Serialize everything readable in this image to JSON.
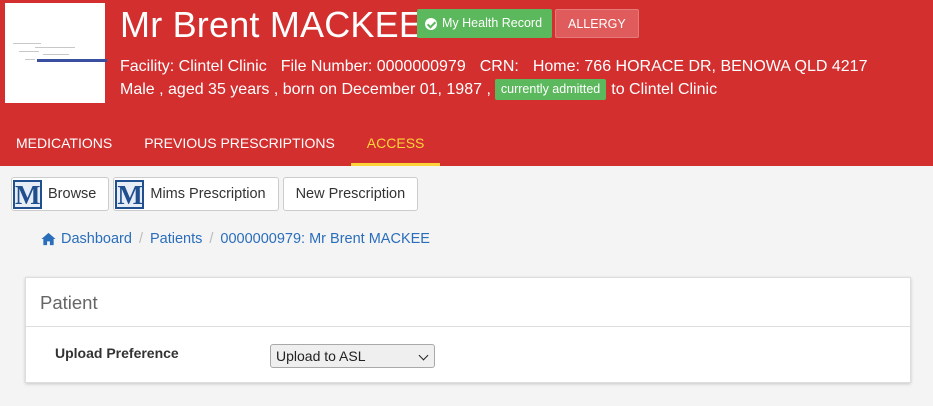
{
  "patient": {
    "name": "Mr Brent MACKEE",
    "badge_mhr": "My Health Record",
    "badge_allergy": "ALLERGY",
    "facility": "Facility: Clintel Clinic",
    "file_number": "File Number: 0000000979",
    "crn": "CRN:",
    "home": "Home: 766 HORACE DR, BENOWA QLD 4217",
    "demographics": "Male , aged 35 years , born on December 01, 1987 ,",
    "admission_status": "currently admitted",
    "admission_facility": "to Clintel Clinic"
  },
  "tabs": [
    {
      "label": "MEDICATIONS"
    },
    {
      "label": "PREVIOUS PRESCRIPTIONS"
    },
    {
      "label": "ACCESS"
    }
  ],
  "toolbar": {
    "browse": "Browse",
    "mims_prescription": "Mims Prescription",
    "new_prescription": "New Prescription",
    "mims_logo": "M"
  },
  "breadcrumb": [
    "Dashboard",
    "Patients",
    "0000000979: Mr Brent MACKEE"
  ],
  "panel": {
    "title": "Patient",
    "upload_label": "Upload Preference",
    "upload_value": "Upload to ASL"
  },
  "colors": {
    "header": "#d32f2f",
    "active_tab": "#ffd43b",
    "success": "#5cb85c",
    "link": "#2a6ebb"
  }
}
